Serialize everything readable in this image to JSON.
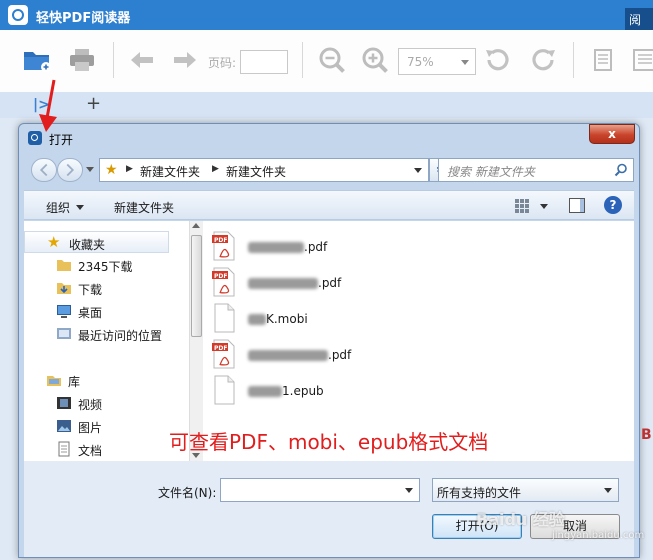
{
  "app": {
    "title": "轻快PDF阅读器",
    "menu_tab": "阅"
  },
  "toolbar": {
    "page_label": "页码:",
    "page_value": "",
    "zoom_value": "75%"
  },
  "tabs": {
    "sidebar_toggle": "|>",
    "add_tab": "+"
  },
  "dialog": {
    "title": "打开",
    "close_label": "x",
    "address": {
      "crumbs": [
        "新建文件夹",
        "新建文件夹"
      ],
      "search_placeholder": "搜索 新建文件夹"
    },
    "commands": {
      "organize": "组织",
      "new_folder": "新建文件夹"
    },
    "nav": {
      "favorites": "收藏夹",
      "fav_items": [
        "2345下载",
        "下载",
        "桌面",
        "最近访问的位置"
      ],
      "library": "库",
      "lib_items": [
        "视频",
        "图片",
        "文档"
      ]
    },
    "files": [
      {
        "suffix": ".pdf",
        "type": "pdf"
      },
      {
        "suffix": ".pdf",
        "type": "pdf"
      },
      {
        "suffix": "K.mobi",
        "type": "generic"
      },
      {
        "suffix": ".pdf",
        "type": "pdf"
      },
      {
        "suffix": "1.epub",
        "type": "generic"
      }
    ],
    "caption": "可查看PDF、mobi、epub格式文档",
    "filename_label": "文件名(N):",
    "filename_value": "",
    "filetype": "所有支持的文件",
    "open_button": "打开(O)",
    "cancel_button": "取消"
  },
  "watermark": {
    "text": "Baidu 经验",
    "domain": "jingyan.baidu.com"
  },
  "edge_text": "B",
  "colors": {
    "titlebar": "#2d7fd0",
    "accent": "#3a7fd0",
    "annotation": "#e11d1d"
  }
}
